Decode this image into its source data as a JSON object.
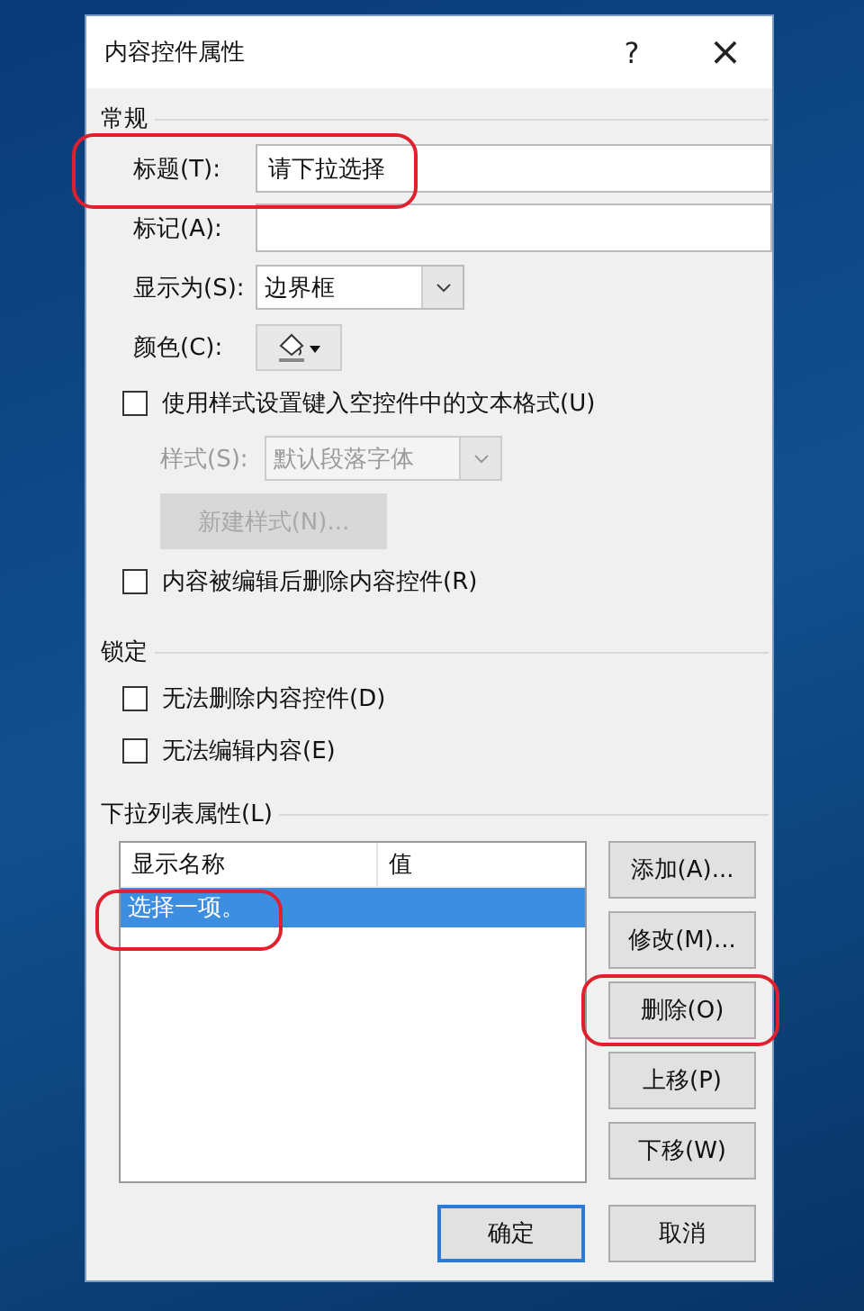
{
  "window": {
    "title": "内容控件属性",
    "help": "?",
    "close": "×"
  },
  "general": {
    "heading": "常规",
    "title_field": {
      "label": "标题(T):",
      "value": "请下拉选择",
      "highlighted": true
    },
    "tag_field": {
      "label": "标记(A):"
    },
    "show_as": {
      "label": "显示为(S):",
      "value": "边界框"
    },
    "color": {
      "label": "颜色(C):"
    },
    "use_style": {
      "label": "使用样式设置键入空控件中的文本格式(U)",
      "checked": false
    },
    "style": {
      "label": "样式(S):",
      "value": "默认段落字体",
      "disabled": true
    },
    "new_style_button": {
      "label": "新建样式(N)...",
      "disabled": true
    },
    "remove_when_edited": {
      "label": "内容被编辑后删除内容控件(R)",
      "checked": false
    }
  },
  "locking": {
    "heading": "锁定",
    "checkboxes": [
      {
        "label": "无法删除内容控件(D)",
        "checked": false
      },
      {
        "label": "无法编辑内容(E)",
        "checked": false
      }
    ]
  },
  "dropdown": {
    "heading": "下拉列表属性(L)",
    "columns": [
      "显示名称",
      "值"
    ],
    "rows": [
      {
        "name": "选择一项。",
        "selected": true,
        "highlighted": true
      }
    ],
    "buttons": [
      {
        "label": "添加(A)...",
        "highlighted": false
      },
      {
        "label": "修改(M)...",
        "highlighted": false
      },
      {
        "label": "删除(O)",
        "highlighted": true
      },
      {
        "label": "上移(P)",
        "highlighted": false
      },
      {
        "label": "下移(W)",
        "highlighted": false
      }
    ]
  },
  "footer_buttons": [
    {
      "label": "确定",
      "default": true
    },
    {
      "label": "取消",
      "default": false
    }
  ]
}
